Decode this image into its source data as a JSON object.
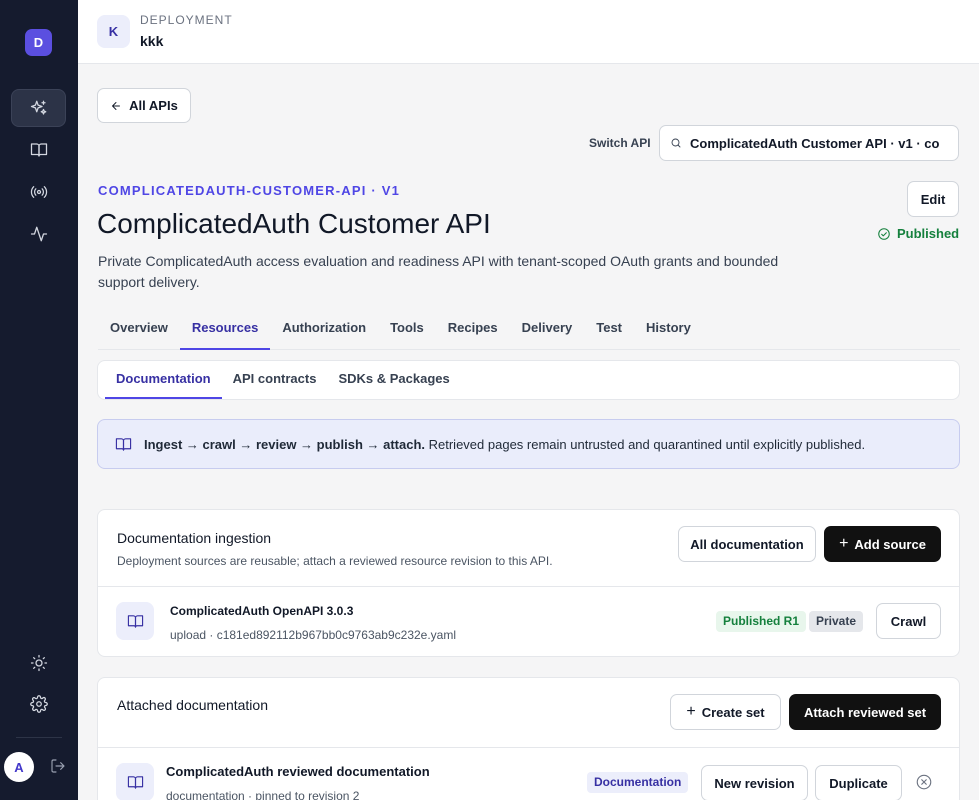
{
  "sidebar": {
    "logo_letter": "D",
    "items": [
      {
        "icon": "sparkles-icon",
        "active": true
      },
      {
        "icon": "book-icon",
        "active": false
      },
      {
        "icon": "broadcast-icon",
        "active": false
      },
      {
        "icon": "activity-icon",
        "active": false
      }
    ],
    "bottom": [
      "sun-icon",
      "gear-icon"
    ],
    "avatar_letter": "A",
    "logout_icon": "logout-icon"
  },
  "header": {
    "badge_letter": "K",
    "label": "DEPLOYMENT",
    "name": "kkk"
  },
  "nav": {
    "back_label": "All APIs",
    "switch_label": "Switch API",
    "switch_value": "ComplicatedAuth Customer API · v1 · co"
  },
  "api": {
    "slug": "COMPLICATEDAUTH-CUSTOMER-API · V1",
    "title": "ComplicatedAuth Customer API",
    "description": "Private ComplicatedAuth access evaluation and readiness API with tenant-scoped OAuth grants and bounded support delivery.",
    "edit_label": "Edit",
    "status": "Published",
    "status_color": "#15803d"
  },
  "tabs": [
    "Overview",
    "Resources",
    "Authorization",
    "Tools",
    "Recipes",
    "Delivery",
    "Test",
    "History"
  ],
  "active_tab": "Resources",
  "subtabs": [
    "Documentation",
    "API contracts",
    "SDKs & Packages"
  ],
  "active_subtab": "Documentation",
  "info": {
    "strong": "Ingest → crawl → review → publish → attach.",
    "text": " Retrieved pages remain untrusted and quarantined until explicitly published."
  },
  "ingestion": {
    "title": "Documentation ingestion",
    "subtitle": "Deployment sources are reusable; attach a reviewed resource revision to this API.",
    "all_docs_label": "All documentation",
    "add_source_label": "Add source",
    "source": {
      "name": "ComplicatedAuth OpenAPI 3.0.3",
      "detail": "upload · c181ed892112b967bb0c9763ab9c232e.yaml",
      "badge_published": "Published R1",
      "badge_private": "Private",
      "crawl_label": "Crawl"
    }
  },
  "attached": {
    "title": "Attached documentation",
    "create_set_label": "Create set",
    "attach_label": "Attach reviewed set",
    "set": {
      "name": "ComplicatedAuth reviewed documentation",
      "detail": "documentation · pinned to revision 2",
      "badge": "Documentation",
      "new_revision_label": "New revision",
      "duplicate_label": "Duplicate"
    }
  },
  "colors": {
    "sidebar_bg": "#151b2e",
    "accent": "#4f46e5",
    "success": "#15803d"
  }
}
